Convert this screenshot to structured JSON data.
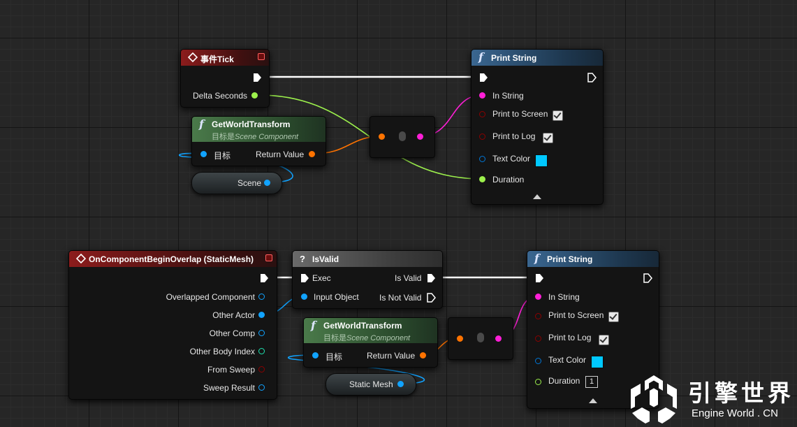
{
  "colors": {
    "exec": "#ffffff",
    "float": "#9cf04c",
    "string": "#ff1fd7",
    "bool": "#8c0000",
    "struct": "#ff7300",
    "object": "#11a3ff",
    "linear_color": "#0077d7",
    "int": "#1fe3af",
    "event_header": "#8c1c1c",
    "function_header": "#3a6690",
    "pure_header": "#4a7a4a"
  },
  "nodes": {
    "event_tick": {
      "title": "事件Tick",
      "icon": "event-diamond-icon",
      "pin_delta": "Delta Seconds"
    },
    "getworld1": {
      "title": "GetWorldTransform",
      "target_prefix": "目标是",
      "target_class": "Scene Component",
      "pin_target": "目标",
      "pin_return": "Return Value"
    },
    "scene_var": {
      "label": "Scene"
    },
    "print1": {
      "title": "Print String",
      "pins": {
        "in_string": "In String",
        "print_screen": "Print to Screen",
        "print_log": "Print to Log",
        "text_color": "Text Color",
        "duration": "Duration"
      },
      "print_screen_checked": true,
      "print_log_checked": true,
      "text_color_value": "#00c8ff"
    },
    "overlap": {
      "title": "OnComponentBeginOverlap (StaticMesh)",
      "pins": [
        "Overlapped Component",
        "Other Actor",
        "Other Comp",
        "Other Body Index",
        "From Sweep",
        "Sweep Result"
      ]
    },
    "isvalid": {
      "title": "IsValid",
      "icon": "question-icon",
      "pin_exec": "Exec",
      "pin_input": "Input Object",
      "pin_valid": "Is Valid",
      "pin_not_valid": "Is Not Valid"
    },
    "getworld2": {
      "title": "GetWorldTransform",
      "target_prefix": "目标是",
      "target_class": "Scene Component",
      "pin_target": "目标",
      "pin_return": "Return Value"
    },
    "mesh_var": {
      "label": "Static Mesh"
    },
    "print2": {
      "title": "Print String",
      "pins": {
        "in_string": "In String",
        "print_screen": "Print to Screen",
        "print_log": "Print to Log",
        "text_color": "Text Color",
        "duration": "Duration"
      },
      "print_screen_checked": true,
      "print_log_checked": true,
      "text_color_value": "#00c8ff",
      "duration_value": "1"
    }
  },
  "watermark": {
    "brand_cn": "引擎世界",
    "brand_en": "Engine World . CN",
    "logo": "engine-world-logo-icon"
  }
}
